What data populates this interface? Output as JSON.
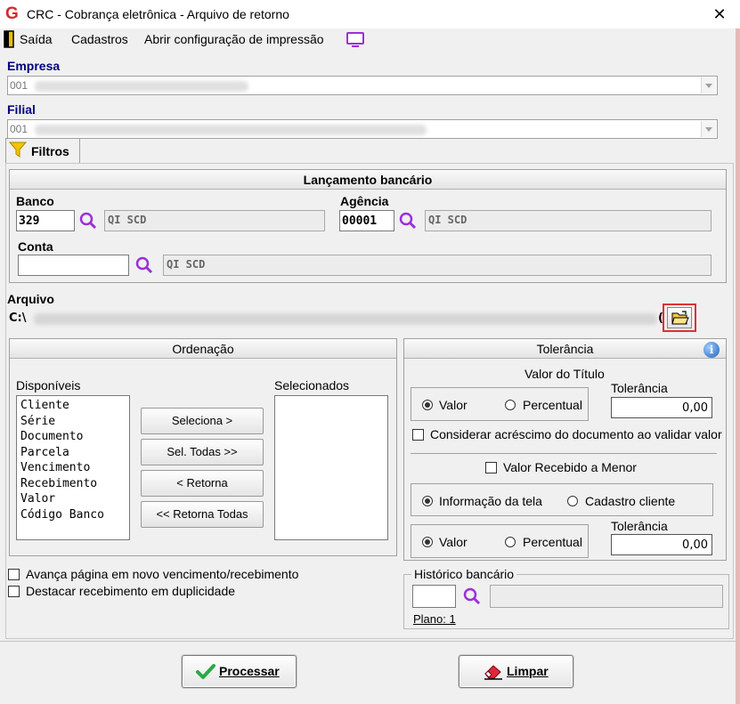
{
  "window": {
    "title": "CRC - Cobrança eletrônica - Arquivo de retorno",
    "close": "✕",
    "app_icon": "G"
  },
  "menu": {
    "exit": "Saída",
    "cadastros": "Cadastros",
    "print_config": "Abrir configuração de impressão"
  },
  "empresa": {
    "label": "Empresa",
    "value": "001"
  },
  "filial": {
    "label": "Filial",
    "value": "001"
  },
  "tabs": [
    {
      "label": "Filtros",
      "icon": "filter-icon"
    }
  ],
  "lancamento": {
    "title": "Lançamento bancário",
    "banco": {
      "label": "Banco",
      "code": "329",
      "name": "QI SCD"
    },
    "agencia": {
      "label": "Agência",
      "code": "00001",
      "name": "QI SCD"
    },
    "conta": {
      "label": "Conta",
      "code": "",
      "name": "QI SCD"
    }
  },
  "arquivo": {
    "label": "Arquivo",
    "value": "C:\\",
    "value_end": "("
  },
  "ordenacao": {
    "title": "Ordenação",
    "available_label": "Disponíveis",
    "selected_label": "Selecionados",
    "available": [
      "Cliente",
      "Série",
      "Documento",
      "Parcela",
      "Vencimento",
      "Recebimento",
      "Valor",
      "Código Banco"
    ],
    "selected": [],
    "buttons": {
      "select": "Seleciona >",
      "select_all": "Sel. Todas >>",
      "return": "< Retorna",
      "return_all": "<< Retorna Todas"
    }
  },
  "tolerancia": {
    "title": "Tolerância",
    "valor_titulo": "Valor do Título",
    "tol_label": "Tolerância",
    "valor": "Valor",
    "percentual": "Percentual",
    "tol_value_1": "0,00",
    "considerar": "Considerar acréscimo do documento ao validar valor",
    "valor_recebido_menor": "Valor Recebido a Menor",
    "info_tela": "Informação da tela",
    "cadastro_cliente": "Cadastro cliente",
    "tol_label_2": "Tolerância",
    "valor_2": "Valor",
    "percentual_2": "Percentual",
    "tol_value_2": "0,00"
  },
  "options": {
    "avanca": "Avança página em novo vencimento/recebimento",
    "destacar": "Destacar recebimento em duplicidade"
  },
  "historico": {
    "title": "Histórico bancário",
    "code": "",
    "name": "",
    "plano": "Plano: 1"
  },
  "actions": {
    "processar": "Processar",
    "limpar": "Limpar"
  },
  "colors": {
    "accent_blue": "#000080",
    "search_icon": "#9b30d9",
    "highlight": "#e03030"
  }
}
